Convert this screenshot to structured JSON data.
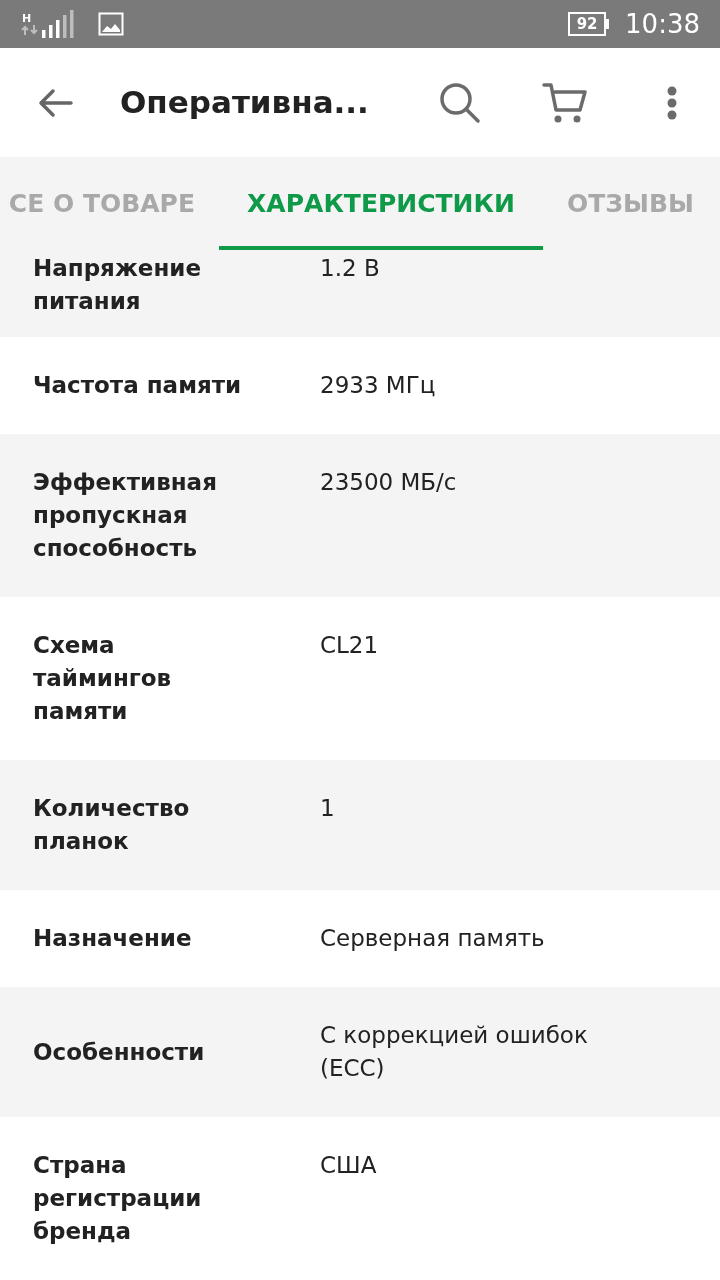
{
  "status_bar": {
    "network_type": "H",
    "battery": "92",
    "time": "10:38"
  },
  "app_bar": {
    "title": "Оперативна..."
  },
  "tabs": [
    {
      "label": "СЕ О ТОВАРЕ",
      "selected": false
    },
    {
      "label": "ХАРАКТЕРИСТИКИ",
      "selected": true
    },
    {
      "label": "ОТЗЫВЫ",
      "selected": false
    }
  ],
  "specs": [
    {
      "name": "Напряжение питания",
      "value": "1.2 В"
    },
    {
      "name": "Частота памяти",
      "value": "2933 МГц"
    },
    {
      "name": "Эффективная пропускная способность",
      "value": "23500 МБ/с"
    },
    {
      "name": "Схема таймингов памяти",
      "value": "CL21"
    },
    {
      "name": "Количество планок",
      "value": "1"
    },
    {
      "name": "Назначение",
      "value": "Серверная память"
    },
    {
      "name": "Особенности",
      "value": "С коррекцией ошибок (ECC)"
    },
    {
      "name": "Страна регистрации бренда",
      "value": "США"
    }
  ]
}
